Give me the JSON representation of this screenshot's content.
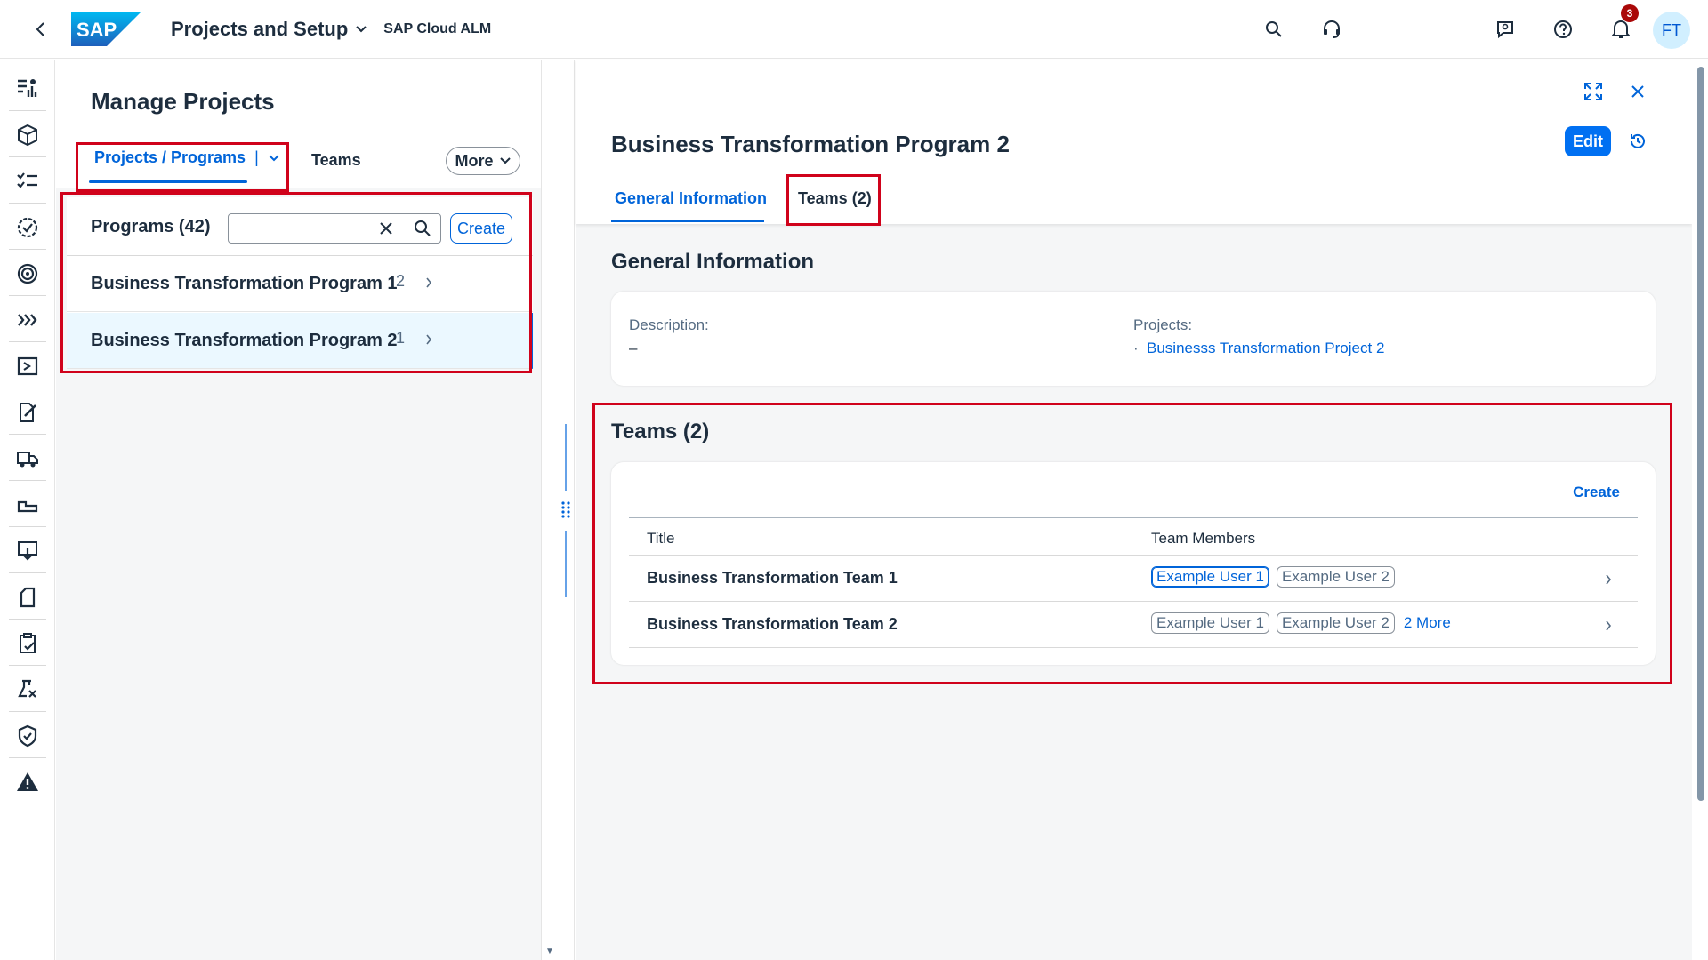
{
  "shell": {
    "title": "Projects and Setup",
    "subtitle": "SAP Cloud ALM",
    "logo_text": "SAP",
    "notification_count": "3",
    "avatar_initials": "FT"
  },
  "master": {
    "title": "Manage Projects",
    "tabs": {
      "projects_programs": "Projects / Programs",
      "teams": "Teams",
      "more": "More"
    },
    "list": {
      "header": "Programs (42)",
      "search_value": "",
      "create_label": "Create",
      "items": [
        {
          "label": "Business Transformation Program 1",
          "count": "2"
        },
        {
          "label": "Business Transformation Program 2",
          "count": "1"
        }
      ]
    }
  },
  "detail": {
    "title": "Business Transformation Program 2",
    "edit_label": "Edit",
    "tabs": {
      "general": "General Information",
      "teams": "Teams (2)"
    },
    "general": {
      "section_title": "General Information",
      "description_label": "Description:",
      "description_value": "–",
      "projects_label": "Projects:",
      "projects": [
        "Businesss Transformation Project 2"
      ]
    },
    "teams": {
      "section_title": "Teams (2)",
      "create_label": "Create",
      "columns": {
        "title": "Title",
        "members": "Team Members"
      },
      "rows": [
        {
          "title": "Business Transformation Team 1",
          "members": [
            "Example User 1",
            "Example User 2"
          ],
          "more": ""
        },
        {
          "title": "Business Transformation Team 2",
          "members": [
            "Example User 1",
            "Example User 2"
          ],
          "more": "2 More"
        }
      ]
    }
  },
  "colors": {
    "accent": "#0064d9",
    "annotation": "#d0021b",
    "badge": "#aa0808"
  }
}
